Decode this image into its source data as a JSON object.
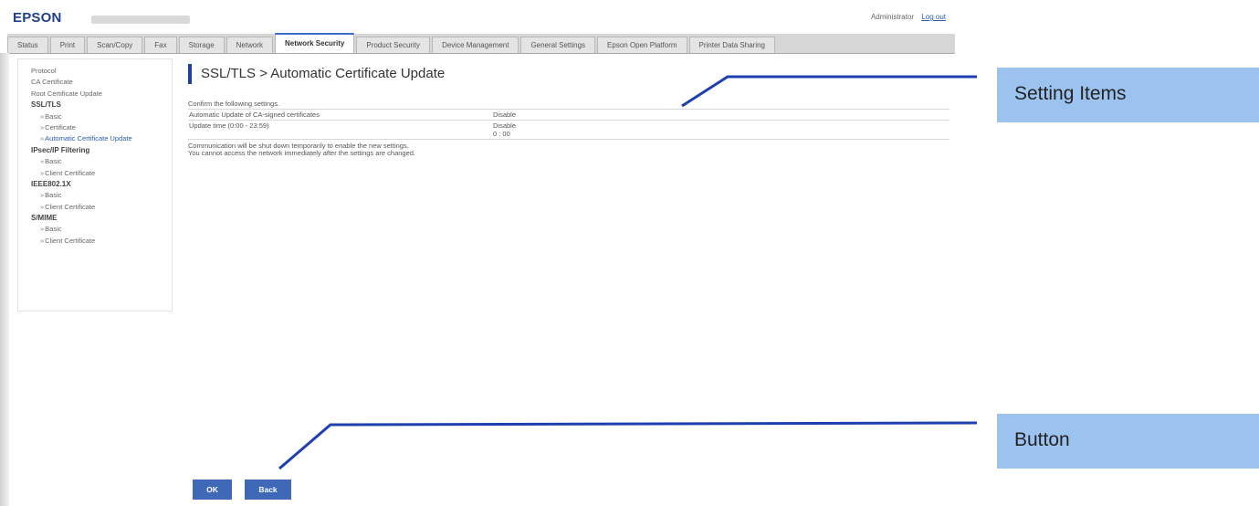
{
  "header": {
    "brand": "EPSON",
    "user_label": "Administrator",
    "logout_label": "Log out"
  },
  "tabs": [
    {
      "label": "Status"
    },
    {
      "label": "Print"
    },
    {
      "label": "Scan/Copy"
    },
    {
      "label": "Fax"
    },
    {
      "label": "Storage"
    },
    {
      "label": "Network"
    },
    {
      "label": "Network Security"
    },
    {
      "label": "Product Security"
    },
    {
      "label": "Device Management"
    },
    {
      "label": "General Settings"
    },
    {
      "label": "Epson Open Platform"
    },
    {
      "label": "Printer Data Sharing"
    }
  ],
  "sidebar": {
    "items": [
      {
        "label": "Protocol",
        "kind": "top"
      },
      {
        "label": "CA Certificate",
        "kind": "top"
      },
      {
        "label": "Root Certificate Update",
        "kind": "top"
      },
      {
        "label": "SSL/TLS",
        "kind": "section"
      },
      {
        "label": "Basic",
        "kind": "sub"
      },
      {
        "label": "Certificate",
        "kind": "sub"
      },
      {
        "label": "Automatic Certificate Update",
        "kind": "sub",
        "active": true
      },
      {
        "label": "IPsec/IP Filtering",
        "kind": "section"
      },
      {
        "label": "Basic",
        "kind": "sub"
      },
      {
        "label": "Client Certificate",
        "kind": "sub"
      },
      {
        "label": "IEEE802.1X",
        "kind": "section"
      },
      {
        "label": "Basic",
        "kind": "sub"
      },
      {
        "label": "Client Certificate",
        "kind": "sub"
      },
      {
        "label": "S/MIME",
        "kind": "section"
      },
      {
        "label": "Basic",
        "kind": "sub"
      },
      {
        "label": "Client Certificate",
        "kind": "sub"
      }
    ]
  },
  "main": {
    "title": "SSL/TLS > Automatic Certificate Update",
    "confirm_text": "Confirm the following settings.",
    "rows": [
      {
        "label": "Automatic Update of CA-signed certificates",
        "value": "Disable",
        "value2": ""
      },
      {
        "label": "Update time (0:00 - 23:59)",
        "value": "Disable",
        "value2": "0 : 00"
      }
    ],
    "note_line1": "Communication will be shut down temporarily to enable the new settings.",
    "note_line2": "You cannot access the network immediately after the settings are changed.",
    "ok_label": "OK",
    "back_label": "Back"
  },
  "callouts": {
    "settings_items": "Setting Items",
    "button": "Button"
  },
  "colors": {
    "brand": "#1f3f8a",
    "accent": "#3f68b8",
    "callout": "#9cc3ef",
    "leader_line": "#1f3fb0"
  }
}
